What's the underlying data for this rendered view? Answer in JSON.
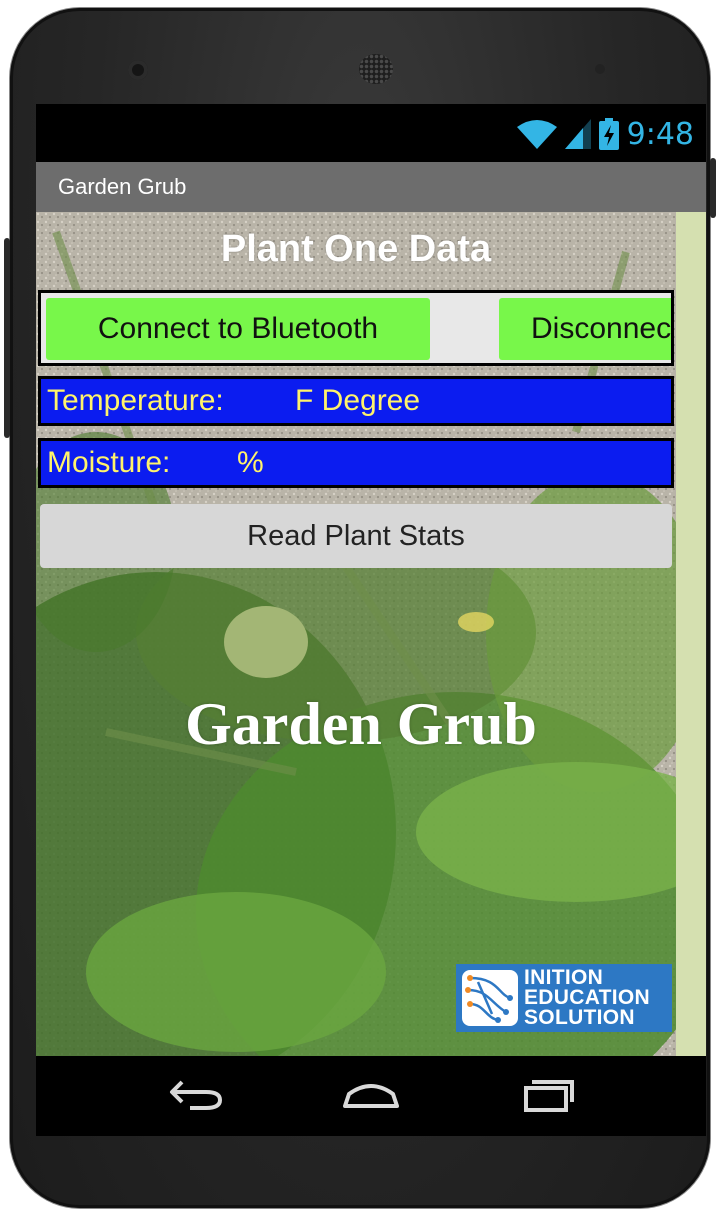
{
  "status_bar": {
    "time": "9:48",
    "icons": [
      "wifi-icon",
      "signal-icon",
      "battery-icon"
    ]
  },
  "app_bar": {
    "title": "Garden Grub"
  },
  "screen": {
    "heading": "Plant One Data",
    "connect_button": "Connect to Bluetooth",
    "disconnect_button": "Disconnect",
    "temperature": {
      "label": "Temperature:",
      "value": "F Degree"
    },
    "moisture": {
      "label": "Moisture:",
      "value": "%"
    },
    "read_button": "Read Plant Stats",
    "brand_title": "Garden Grub",
    "logo": {
      "line1": "INITION",
      "line2": "EDUCATION",
      "line3": "SOLUTION"
    }
  },
  "colors": {
    "connect_green": "#78f74a",
    "data_blue": "#0b1cf0",
    "data_text_yellow": "#fff36b",
    "status_blue": "#33b5e5",
    "titlebar_gray": "#6d6d6d",
    "logo_blue": "#2d78c4"
  },
  "navigation": {
    "buttons": [
      "back-icon",
      "home-icon",
      "recent-apps-icon"
    ]
  }
}
